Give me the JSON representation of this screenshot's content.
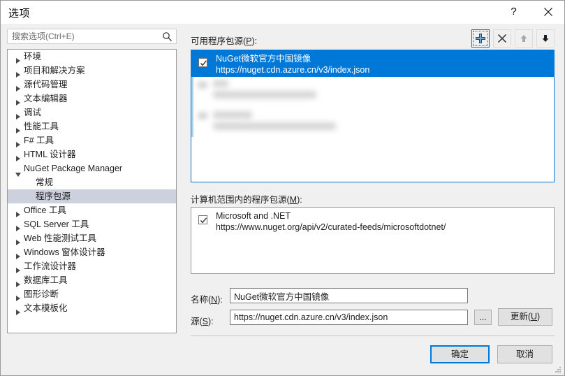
{
  "window": {
    "title": "选项",
    "help_label": "?",
    "close_label": "✕"
  },
  "search": {
    "placeholder": "搜索选项(Ctrl+E)",
    "value": "",
    "icon": "search-icon"
  },
  "tree": {
    "items": [
      {
        "label": "环境",
        "level": 0,
        "expander": "closed",
        "selected": false
      },
      {
        "label": "项目和解决方案",
        "level": 0,
        "expander": "closed",
        "selected": false
      },
      {
        "label": "源代码管理",
        "level": 0,
        "expander": "closed",
        "selected": false
      },
      {
        "label": "文本编辑器",
        "level": 0,
        "expander": "closed",
        "selected": false
      },
      {
        "label": "调试",
        "level": 0,
        "expander": "closed",
        "selected": false
      },
      {
        "label": "性能工具",
        "level": 0,
        "expander": "closed",
        "selected": false
      },
      {
        "label": "F# 工具",
        "level": 0,
        "expander": "closed",
        "selected": false
      },
      {
        "label": "HTML 设计器",
        "level": 0,
        "expander": "closed",
        "selected": false
      },
      {
        "label": "NuGet Package Manager",
        "level": 0,
        "expander": "open",
        "selected": false
      },
      {
        "label": "常规",
        "level": 1,
        "expander": "none",
        "selected": false
      },
      {
        "label": "程序包源",
        "level": 1,
        "expander": "none",
        "selected": true
      },
      {
        "label": "Office 工具",
        "level": 0,
        "expander": "closed",
        "selected": false
      },
      {
        "label": "SQL Server 工具",
        "level": 0,
        "expander": "closed",
        "selected": false
      },
      {
        "label": "Web 性能测试工具",
        "level": 0,
        "expander": "closed",
        "selected": false
      },
      {
        "label": "Windows 窗体设计器",
        "level": 0,
        "expander": "closed",
        "selected": false
      },
      {
        "label": "工作流设计器",
        "level": 0,
        "expander": "closed",
        "selected": false
      },
      {
        "label": "数据库工具",
        "level": 0,
        "expander": "closed",
        "selected": false
      },
      {
        "label": "图形诊断",
        "level": 0,
        "expander": "closed",
        "selected": false
      },
      {
        "label": "文本模板化",
        "level": 0,
        "expander": "closed",
        "selected": false
      }
    ]
  },
  "available": {
    "label": "可用程序包源(P):",
    "toolbar": {
      "add": "add-source-button",
      "remove": "remove-source-button",
      "move_up": "move-up-button",
      "move_down": "move-down-button"
    },
    "sources": [
      {
        "name": "NuGet微软官方中国镜像",
        "url": "https://nuget.cdn.azure.cn/v3/index.json",
        "checked": true,
        "selected": true,
        "redacted": false
      },
      {
        "name": "",
        "url": "",
        "checked": true,
        "selected": false,
        "redacted": true
      },
      {
        "name": "",
        "url": "",
        "checked": true,
        "selected": false,
        "redacted": true
      }
    ]
  },
  "machine": {
    "label": "计算机范围内的程序包源(M):",
    "sources": [
      {
        "name": "Microsoft and .NET",
        "url": "https://www.nuget.org/api/v2/curated-feeds/microsoftdotnet/",
        "checked": true
      }
    ]
  },
  "form": {
    "name_label": "名称(N):",
    "name_value": "NuGet微软官方中国镜像",
    "source_label": "源(S):",
    "source_value": "https://nuget.cdn.azure.cn/v3/index.json",
    "browse_label": "...",
    "update_label": "更新(U)"
  },
  "footer": {
    "ok_label": "确定",
    "cancel_label": "取消"
  },
  "colors": {
    "selection_blue": "#0078d7",
    "tree_selection": "#cdd1de",
    "dialog_bg": "#f0f0f0",
    "field_bg": "#ffffff"
  }
}
